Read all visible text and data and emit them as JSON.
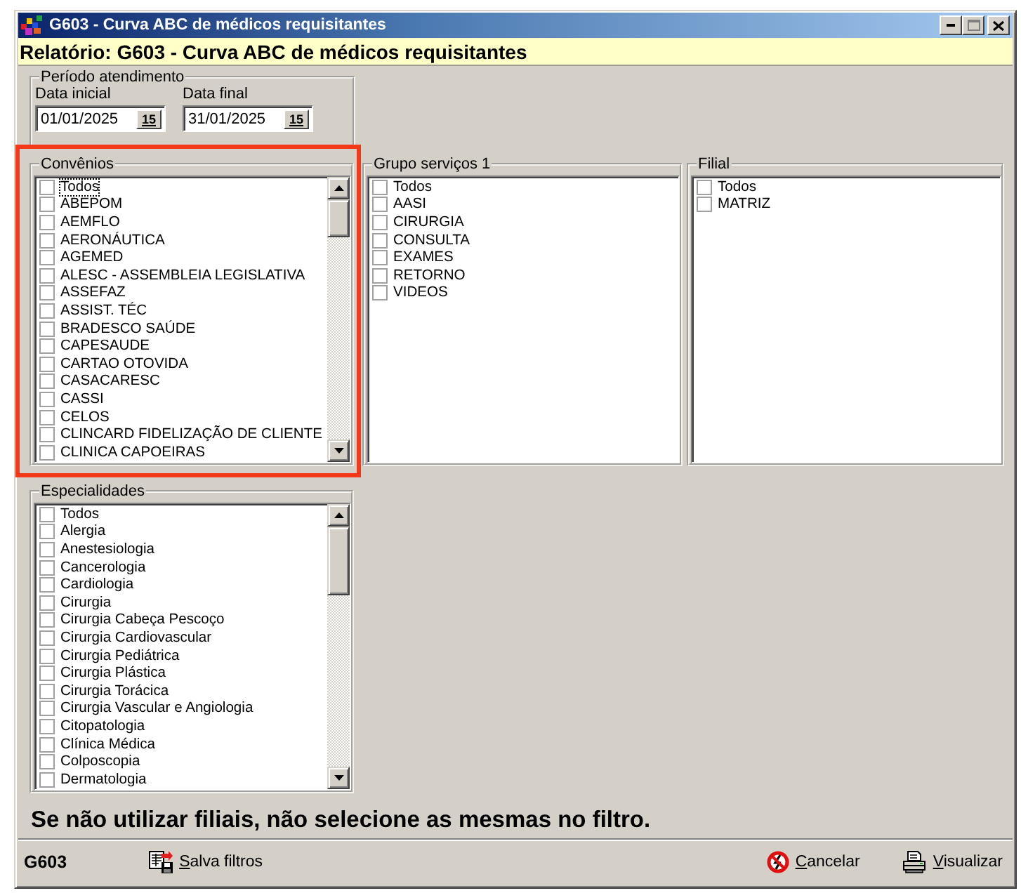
{
  "window": {
    "title": "G603 - Curva ABC de médicos requisitantes"
  },
  "header": {
    "text": "Relatório: G603 - Curva ABC de médicos requisitantes"
  },
  "period": {
    "legend": "Período atendimento",
    "fields": [
      {
        "label": "Data inicial",
        "value": "01/01/2025",
        "calendar": "15"
      },
      {
        "label": "Data final",
        "value": "31/01/2025",
        "calendar": "15"
      }
    ]
  },
  "convenios": {
    "legend": "Convênios",
    "highlighted": true,
    "scrollable": true,
    "items": [
      {
        "label": "Todos",
        "checked": false,
        "focused": true
      },
      {
        "label": "ABEPOM",
        "checked": false,
        "focused": false
      },
      {
        "label": "AEMFLO",
        "checked": false,
        "focused": false
      },
      {
        "label": "AERONÁUTICA",
        "checked": false,
        "focused": false
      },
      {
        "label": "AGEMED",
        "checked": false,
        "focused": false
      },
      {
        "label": "ALESC - ASSEMBLEIA LEGISLATIVA",
        "checked": false,
        "focused": false
      },
      {
        "label": "ASSEFAZ",
        "checked": false,
        "focused": false
      },
      {
        "label": "ASSIST. TÉC",
        "checked": false,
        "focused": false
      },
      {
        "label": "BRADESCO SAÚDE",
        "checked": false,
        "focused": false
      },
      {
        "label": "CAPESAUDE",
        "checked": false,
        "focused": false
      },
      {
        "label": "CARTAO OTOVIDA",
        "checked": false,
        "focused": false
      },
      {
        "label": "CASACARESC",
        "checked": false,
        "focused": false
      },
      {
        "label": "CASSI",
        "checked": false,
        "focused": false
      },
      {
        "label": "CELOS",
        "checked": false,
        "focused": false
      },
      {
        "label": "CLINCARD FIDELIZAÇÃO DE CLIENTE",
        "checked": false,
        "focused": false
      },
      {
        "label": "CLINICA CAPOEIRAS",
        "checked": false,
        "focused": false
      }
    ]
  },
  "grupo_servicos": {
    "legend": "Grupo serviços 1",
    "scrollable": false,
    "items": [
      {
        "label": "Todos",
        "checked": false
      },
      {
        "label": "AASI",
        "checked": false
      },
      {
        "label": "CIRURGIA",
        "checked": false
      },
      {
        "label": "CONSULTA",
        "checked": false
      },
      {
        "label": "EXAMES",
        "checked": false
      },
      {
        "label": "RETORNO",
        "checked": false
      },
      {
        "label": "VIDEOS",
        "checked": false
      }
    ]
  },
  "filial": {
    "legend": "Filial",
    "scrollable": false,
    "items": [
      {
        "label": "Todos",
        "checked": false
      },
      {
        "label": "MATRIZ",
        "checked": false
      }
    ]
  },
  "especialidades": {
    "legend": "Especialidades",
    "scrollable": true,
    "items": [
      {
        "label": "Todos",
        "checked": false
      },
      {
        "label": "Alergia",
        "checked": false
      },
      {
        "label": "Anestesiologia",
        "checked": false
      },
      {
        "label": "Cancerologia",
        "checked": false
      },
      {
        "label": "Cardiologia",
        "checked": false
      },
      {
        "label": "Cirurgia",
        "checked": false
      },
      {
        "label": "Cirurgia Cabeça Pescoço",
        "checked": false
      },
      {
        "label": "Cirurgia Cardiovascular",
        "checked": false
      },
      {
        "label": "Cirurgia Pediátrica",
        "checked": false
      },
      {
        "label": "Cirurgia Plástica",
        "checked": false
      },
      {
        "label": "Cirurgia Torácica",
        "checked": false
      },
      {
        "label": "Cirurgia Vascular e Angiologia",
        "checked": false
      },
      {
        "label": "Citopatologia",
        "checked": false
      },
      {
        "label": "Clínica Médica",
        "checked": false
      },
      {
        "label": "Colposcopia",
        "checked": false
      },
      {
        "label": "Dermatologia",
        "checked": false
      }
    ]
  },
  "note": "Se não utilizar filiais, não selecione as mesmas no filtro.",
  "footer": {
    "code": "G603",
    "buttons": [
      {
        "kind": "save",
        "label": "Salva filtros"
      },
      {
        "kind": "cancel",
        "label": "Cancelar"
      },
      {
        "kind": "preview",
        "label": "Visualizar"
      }
    ]
  }
}
